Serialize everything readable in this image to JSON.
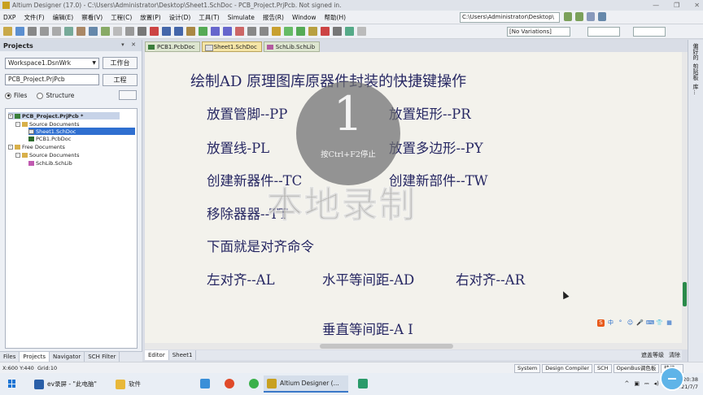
{
  "window": {
    "title": "Altium Designer (17.0) - C:\\Users\\Administrator\\Desktop\\Sheet1.SchDoc - PCB_Project.PrjPcb. Not signed in.",
    "controls": [
      "—",
      "❐",
      "✕"
    ]
  },
  "menu": {
    "items": [
      "DXP",
      "文件(F)",
      "编辑(E)",
      "察看(V)",
      "工程(C)",
      "放置(P)",
      "设计(D)",
      "工具(T)",
      "Simulate",
      "报告(R)",
      "Window",
      "帮助(H)"
    ],
    "path": "C:\\Users\\Administrator\\Desktop\\"
  },
  "toolbar": {
    "variations": "[No Variations]"
  },
  "projects_panel": {
    "title": "Projects",
    "controls": "▾ ✕",
    "workspace": "Workspace1.DsnWrk",
    "workspace_button": "工作台",
    "project_field": "PCB_Project.PrjPcb",
    "project_button": "工程",
    "view_files": "Files",
    "view_structure": "Structure",
    "tree": [
      {
        "label": "PCB_Project.PrjPcb *",
        "expander": "-"
      },
      {
        "label": "Source Documents",
        "expander": "-"
      },
      {
        "label": "Sheet1.SchDoc"
      },
      {
        "label": "PCB1.PcbDoc"
      },
      {
        "label": "Free Documents",
        "expander": "-"
      },
      {
        "label": "Source Documents",
        "expander": "-"
      },
      {
        "label": "SchLib.SchLib"
      }
    ],
    "tabs": [
      "Files",
      "Projects",
      "Navigator",
      "SCH Filter"
    ]
  },
  "doc_tabs": [
    "PCB1.PcbDoc",
    "Sheet1.SchDoc",
    "SchLib.SchLib"
  ],
  "canvas": {
    "title": "绘制AD 原理图库原器件封装的快捷键操作",
    "lines": [
      "放置管脚--PP",
      "放置矩形--PR",
      "放置线-PL",
      "放置多边形--PY",
      "创建新器件--TC",
      "创建新部件--TW",
      "移除器器--TT",
      "下面就是对齐命令",
      "左对齐--AL",
      "水平等间距-AD",
      "右对齐--AR",
      "垂直等间距-A I"
    ],
    "overlay_number": "1",
    "overlay_hint": "按Ctrl+F2停止",
    "watermark": "本地录制",
    "ime": [
      "S",
      "中",
      "°",
      "☺",
      "🎤",
      "⌨",
      "👕",
      "▦"
    ]
  },
  "right_strip": [
    "偏好的",
    "剪贴板",
    "库..."
  ],
  "editor_tabs": [
    "Editor",
    "Sheet1"
  ],
  "editor_right": [
    "遮盖等级",
    "清除"
  ],
  "status": {
    "coords": "X:600 Y:440",
    "grid": "Grid:10",
    "buttons": [
      "System",
      "Design Compiler",
      "SCH",
      "OpenBus调色板",
      "快捷..."
    ]
  },
  "taskbar": {
    "items": [
      "ev录屏 - \"此电脑\"",
      "软件",
      "Altium Designer (..."
    ],
    "time": "20:38",
    "date": "2021/7/7"
  },
  "colors": {
    "canvas_bg": "#f3f2ec",
    "canvas_text": "#272863",
    "selection": "#2f6fd0",
    "active_tab": "#f5e5a6"
  }
}
